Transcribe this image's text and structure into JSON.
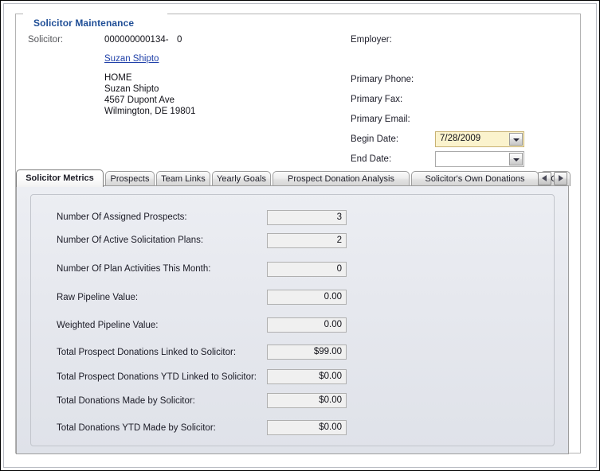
{
  "window": {
    "group_title": "Solicitor Maintenance"
  },
  "header": {
    "solicitor_label": "Solicitor:",
    "solicitor_id": "000000000134-",
    "solicitor_seq": "0",
    "solicitor_link": "Suzan Shipto",
    "address": [
      "HOME",
      "Suzan Shipto",
      "4567 Dupont Ave",
      "Wilmington, DE 19801"
    ],
    "employer_label": "Employer:",
    "employer_value": "",
    "primary_phone_label": "Primary Phone:",
    "primary_phone_value": "",
    "primary_fax_label": "Primary Fax:",
    "primary_fax_value": "",
    "primary_email_label": "Primary Email:",
    "primary_email_value": "",
    "begin_date_label": "Begin Date:",
    "begin_date_value": "7/28/2009",
    "end_date_label": "End Date:",
    "end_date_value": ""
  },
  "tabs": {
    "selected_index": 0,
    "items": [
      {
        "label": "Solicitor Metrics"
      },
      {
        "label": "Prospects"
      },
      {
        "label": "Team Links"
      },
      {
        "label": "Yearly Goals"
      },
      {
        "label": "Prospect Donation Analysis"
      },
      {
        "label": "Solicitor's Own Donations"
      },
      {
        "label": "Cr"
      }
    ],
    "scroll_left": "◄",
    "scroll_right": "►"
  },
  "metrics": [
    {
      "label": "Number Of Assigned Prospects:",
      "value": "3"
    },
    {
      "label": "Number Of Active Solicitation Plans:",
      "value": "2"
    },
    {
      "label": "Number Of Plan Activities This Month:",
      "value": "0"
    },
    {
      "label": "Raw Pipeline Value:",
      "value": "0.00"
    },
    {
      "label": "Weighted Pipeline Value:",
      "value": "0.00"
    },
    {
      "label": "Total Prospect Donations Linked to Solicitor:",
      "value": "$99.00"
    },
    {
      "label": "Total Prospect Donations YTD Linked to Solicitor:",
      "value": "$0.00"
    },
    {
      "label": "Total Donations Made by Solicitor:",
      "value": "$0.00"
    },
    {
      "label": "Total Donations YTD Made by Solicitor:",
      "value": "$0.00"
    }
  ],
  "colors": {
    "title_blue": "#1f4e96",
    "link_blue": "#1e3fa8",
    "highlight_field": "#fbf3cd",
    "panel_bg": "#e6e8ee",
    "readonly_field": "#f0f0f0"
  }
}
